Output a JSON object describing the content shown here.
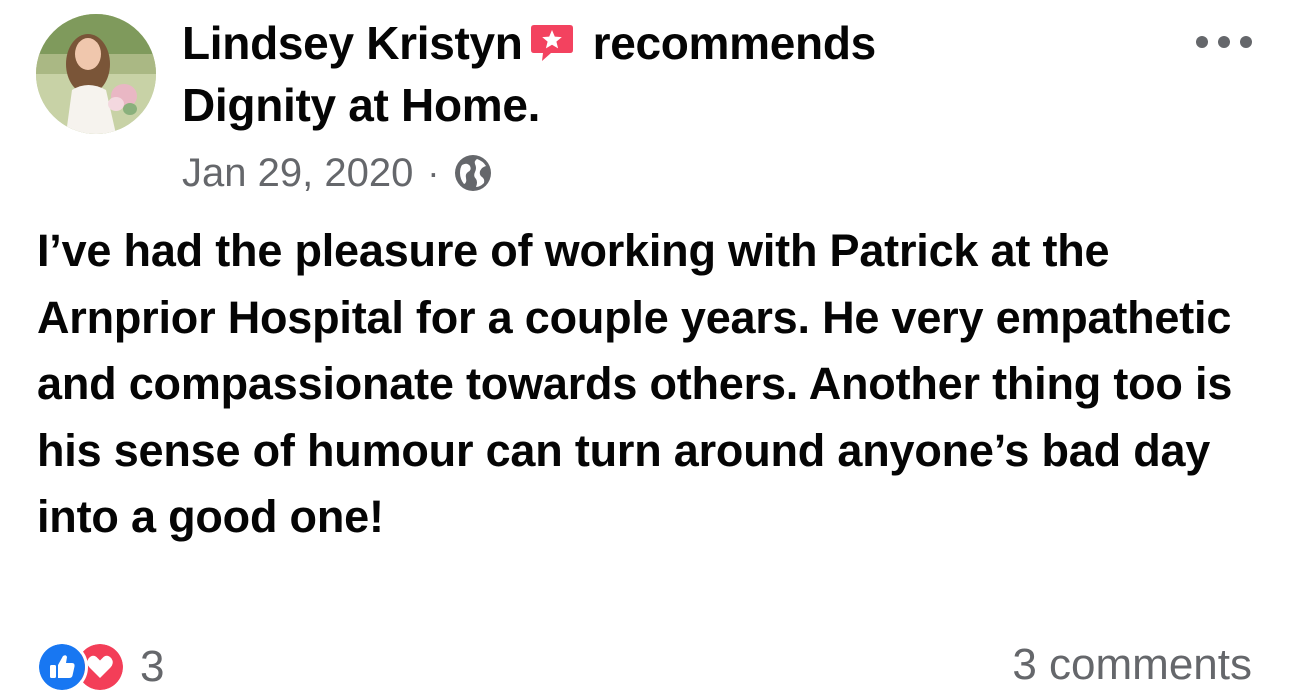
{
  "post": {
    "author": "Lindsey Kristyn",
    "action": "recommends",
    "page_name": "Dignity at Home.",
    "date": "Jan 29, 2020",
    "separator": "·",
    "privacy_icon": "globe-icon",
    "recommendation_icon": "recommend-star-icon",
    "more_icon": "more-options-icon",
    "body": "I’ve had the pleasure of working with Patrick at the Arnprior Hospital for a couple years. He very empathetic and compassionate towards others. Another thing too is his sense of humour can turn around anyone’s bad day into a good one!"
  },
  "footer": {
    "reaction_icons": [
      "like-icon",
      "love-icon"
    ],
    "reaction_count": "3",
    "comments_label": "3 comments"
  },
  "colors": {
    "text": "#050505",
    "secondary_text": "#65676b",
    "like_blue": "#1877f2",
    "love_red": "#f33e58",
    "recommend_badge": "#f3425f"
  }
}
